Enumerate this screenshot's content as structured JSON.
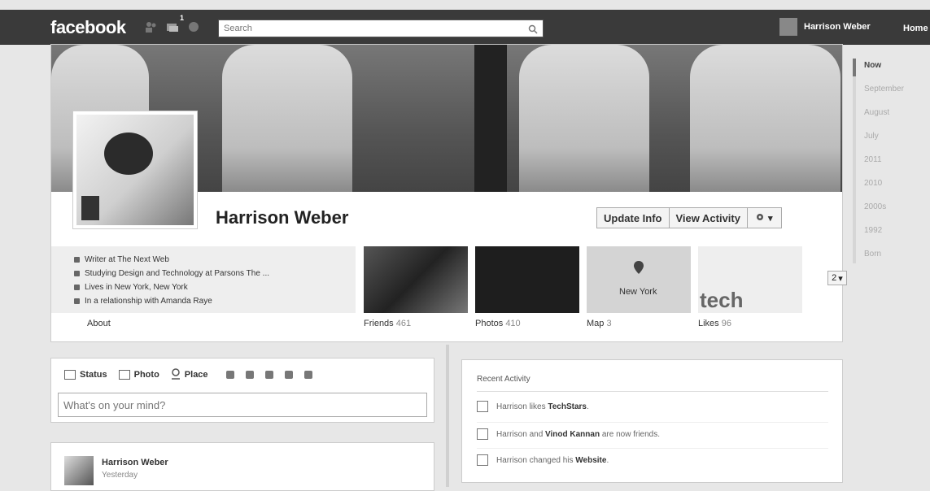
{
  "topbar": {
    "logo": "facebook",
    "notification_count": "1",
    "search_placeholder": "Search",
    "user_name": "Harrison Weber",
    "home_label": "Home"
  },
  "profile": {
    "name": "Harrison Weber",
    "buttons": {
      "update_info": "Update Info",
      "view_activity": "View Activity"
    },
    "about_items": [
      {
        "icon": "briefcase-icon",
        "text": "Writer at The Next Web"
      },
      {
        "icon": "education-icon",
        "text": "Studying Design and Technology at Parsons The ..."
      },
      {
        "icon": "home-icon",
        "text": "Lives in New York, New York"
      },
      {
        "icon": "heart-icon",
        "text": "In a relationship with Amanda Raye"
      }
    ],
    "about_label": "About",
    "tiles": [
      {
        "label": "Friends",
        "count": "461"
      },
      {
        "label": "Photos",
        "count": "410"
      },
      {
        "label": "Map",
        "count": "3"
      },
      {
        "label": "Likes",
        "count": "96"
      }
    ],
    "more_count": "2",
    "map_text": "New York",
    "likes_tile_text": "tech"
  },
  "timeline_years": [
    "Now",
    "September",
    "August",
    "July",
    "2011",
    "2010",
    "2000s",
    "1992",
    "Born"
  ],
  "composer": {
    "tabs": [
      "Status",
      "Photo",
      "Place"
    ],
    "placeholder": "What's on your mind?"
  },
  "story": {
    "name": "Harrison Weber",
    "time": "Yesterday"
  },
  "recent_activity": {
    "title": "Recent Activity",
    "items": [
      {
        "pre": "Harrison likes ",
        "bold": "TechStars",
        "post": "."
      },
      {
        "pre": "Harrison and ",
        "bold": "Vinod Kannan",
        "post": " are now friends."
      },
      {
        "pre": "Harrison changed his ",
        "bold": "Website",
        "post": "."
      }
    ]
  }
}
